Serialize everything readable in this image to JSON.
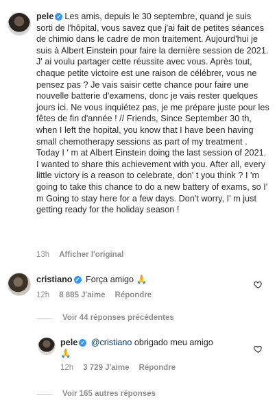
{
  "caption": {
    "username": "pele",
    "text": "Les amis, depuis le 30 septembre, quand je suis sorti de l'hôpital, vous savez que j'ai fait de petites séances de chimio dans le cadre de mon traitement. Aujourd'hui je suis à Albert Einstein pour faire la dernière session de 2021. J' ai voulu partager cette réussite avec vous. Après tout, chaque petite victoire est une raison de célébrer, vous ne pensez pas ? Je vais saisir cette chance pour faire une nouvelle batterie d'examens, donc je vais rester quelques jours ici. Ne vous inquiétez pas, je me prépare juste pour les fêtes de fin d'année ! // Friends, Since September 30 th, when I left the hopital, you know that I have been having small chemotherapy sessions as part of my treatment . Today I ' m at Albert Einstein doing the last session of 2021. I wanted to share this achievement with you. After all, every little victory is a reason to celebrate, don' t you think ? I 'm going to take this chance to do a new battery of exams, so I' m Going to stay here for a few days. Don't worry, I' m just getting ready for the holiday season !",
    "time": "13h",
    "translate": "Afficher l'original"
  },
  "comment1": {
    "username": "cristiano",
    "text": "Força amigo",
    "emoji": "🙏",
    "time": "12h",
    "likes": "8 885 J'aime",
    "reply": "Répondre"
  },
  "view_previous": "Voir 44 réponses précédentes",
  "reply1": {
    "username": "pele",
    "mention": "@cristiano",
    "text": "obrigado meu amigo",
    "emoji": "🙏",
    "time": "12h",
    "likes": "3 729 J'aime",
    "reply": "Répondre"
  },
  "view_more": "Voir 165 autres réponses",
  "icons": {
    "verified": "verified-badge-icon",
    "heart": "heart-outline-icon"
  }
}
